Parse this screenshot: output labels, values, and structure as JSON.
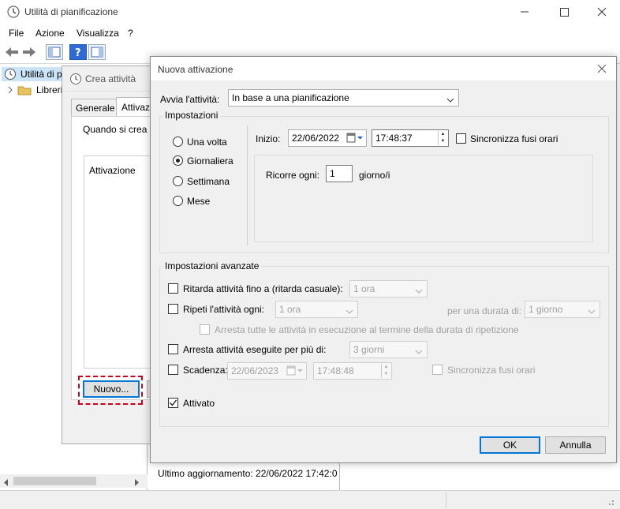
{
  "main_window": {
    "title": "Utilità di pianificazione",
    "menu": [
      "File",
      "Azione",
      "Visualizza",
      "?"
    ],
    "tree": {
      "root_label": "Utilità di p",
      "child_label": "Libreri"
    },
    "status_text": "Ultimo aggiornamento: 22/06/2022 17:42:0"
  },
  "crea_dialog": {
    "title": "Crea attività",
    "tabs": [
      "Generale",
      "Attivazi"
    ],
    "description_prefix": "Quando si crea u",
    "list_header": "Attivazione",
    "new_button": "Nuovo..."
  },
  "nuova_dialog": {
    "title": "Nuova attivazione",
    "start_task_label": "Avvia l'attività:",
    "start_task_value": "In base a una pianificazione",
    "settings_legend": "Impostazioni",
    "frequency_options": [
      "Una volta",
      "Giornaliera",
      "Settimana",
      "Mese"
    ],
    "selected_frequency": "Giornaliera",
    "start_label": "Inizio:",
    "start_date": "22/06/2022",
    "start_time": "17:48:37",
    "sync_timezones_label": "Sincronizza fusi orari",
    "recur_label": "Ricorre ogni:",
    "recur_value": "1",
    "recur_unit": "giorno/i",
    "advanced_legend": "Impostazioni avanzate",
    "delay_label": "Ritarda attività fino a (ritarda casuale):",
    "delay_value": "1 ora",
    "repeat_label": "Ripeti l'attività ogni:",
    "repeat_value": "1 ora",
    "duration_label": "per una durata di:",
    "duration_value": "1 giorno",
    "stop_all_label": "Arresta tutte le attività in esecuzione al termine della durata di ripetizione",
    "stop_longer_label": "Arresta attività eseguite per più di:",
    "stop_longer_value": "3 giorni",
    "expire_label": "Scadenza:",
    "expire_date": "22/06/2023",
    "expire_time": "17:48:48",
    "expire_sync_label": "Sincronizza fusi orari",
    "enabled_label": "Attivato",
    "enabled_checked": true,
    "ok_button": "OK",
    "cancel_button": "Annulla"
  },
  "colors": {
    "highlight_dashed": "#d0021b",
    "focus_blue": "#0078d7",
    "dialog_bg": "#f0f0f0"
  }
}
